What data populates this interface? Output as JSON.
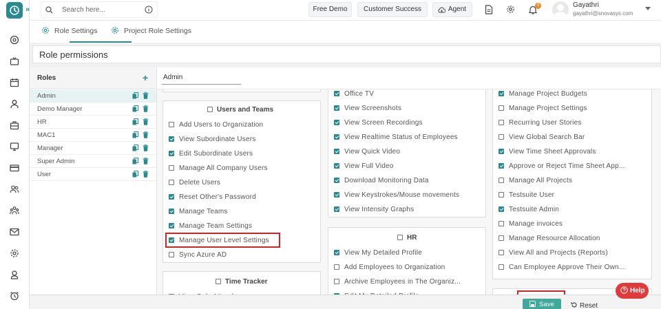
{
  "topbar": {
    "search_placeholder": "Search here...",
    "buttons": [
      "Free Demo",
      "Customer Success",
      "Agent"
    ],
    "notification_count": "6",
    "user_name": "Gayathri",
    "user_email": "gayathri@snovasys.com"
  },
  "tabs": [
    "Role Settings",
    "Project Role Settings"
  ],
  "page_title": "Role permissions",
  "roles": {
    "header": "Roles",
    "items": [
      "Admin",
      "Demo Manager",
      "HR",
      "MAC1",
      "Manager",
      "Super Admin",
      "User"
    ],
    "selected": "Admin"
  },
  "role_name_value": "Admin",
  "column1": {
    "groups": [
      {
        "title": "Users and Teams",
        "checked": false,
        "items": [
          {
            "label": "Add Users to Organization",
            "checked": false
          },
          {
            "label": "View Subordinate Users",
            "checked": true
          },
          {
            "label": "Edit Subordinate Users",
            "checked": true
          },
          {
            "label": "Manage All Company Users",
            "checked": false
          },
          {
            "label": "Delete Users",
            "checked": false
          },
          {
            "label": "Reset Other's Password",
            "checked": true
          },
          {
            "label": "Manage Teams",
            "checked": true
          },
          {
            "label": "Manage Team Settings",
            "checked": true
          },
          {
            "label": "Manage User Level Settings",
            "checked": true
          },
          {
            "label": "Sync Azure AD",
            "checked": false
          }
        ]
      },
      {
        "title": "Time Tracker",
        "checked": false,
        "items": [
          {
            "label": "View Only Attendance",
            "checked": false
          }
        ]
      }
    ]
  },
  "column2": {
    "groups": [
      {
        "title": "",
        "items": [
          {
            "label": "Office TV",
            "checked": true
          },
          {
            "label": "View Screenshots",
            "checked": true
          },
          {
            "label": "View Screen Recordings",
            "checked": true
          },
          {
            "label": "View Realtime Status of Employees",
            "checked": true
          },
          {
            "label": "View Quick Video",
            "checked": true
          },
          {
            "label": "View Full Video",
            "checked": true
          },
          {
            "label": "Download Monitoring Data",
            "checked": true
          },
          {
            "label": "View Keystrokes/Mouse movements",
            "checked": true
          },
          {
            "label": "View Intensity Graphs",
            "checked": true
          }
        ]
      },
      {
        "title": "HR",
        "checked": false,
        "items": [
          {
            "label": "View My Detailed Profile",
            "checked": true
          },
          {
            "label": "Add Employees to Organization",
            "checked": false
          },
          {
            "label": "Archive Employees in The Organiz...",
            "checked": false
          },
          {
            "label": "Edit My Detailed Profile",
            "checked": true
          }
        ]
      }
    ]
  },
  "column3": {
    "groups": [
      {
        "title": "",
        "items": [
          {
            "label": "Manage Project Budgets",
            "checked": true
          },
          {
            "label": "Manage Project Settings",
            "checked": false
          },
          {
            "label": "Recurring User Stories",
            "checked": false
          },
          {
            "label": "View Global Search Bar",
            "checked": false
          },
          {
            "label": "View Time Sheet Approvals",
            "checked": true
          },
          {
            "label": "Approve or Reject Time Sheet App...",
            "checked": true
          },
          {
            "label": "Manage All Projects",
            "checked": false
          },
          {
            "label": "Testsuite User",
            "checked": false
          },
          {
            "label": "Testsuite Admin",
            "checked": true
          },
          {
            "label": "Manage invoices",
            "checked": false
          },
          {
            "label": "Manage Resource Allocation",
            "checked": false
          },
          {
            "label": "View All and Projects (Reports)",
            "checked": false
          },
          {
            "label": "Can Employee Approve Their Own...",
            "checked": false
          }
        ]
      }
    ]
  },
  "actions": {
    "save": "Save",
    "reset": "Reset",
    "help": "Help"
  },
  "colors": {
    "accent": "#2a8a90",
    "save": "#41a89c",
    "help": "#e03a3a",
    "highlight": "#d32424"
  }
}
